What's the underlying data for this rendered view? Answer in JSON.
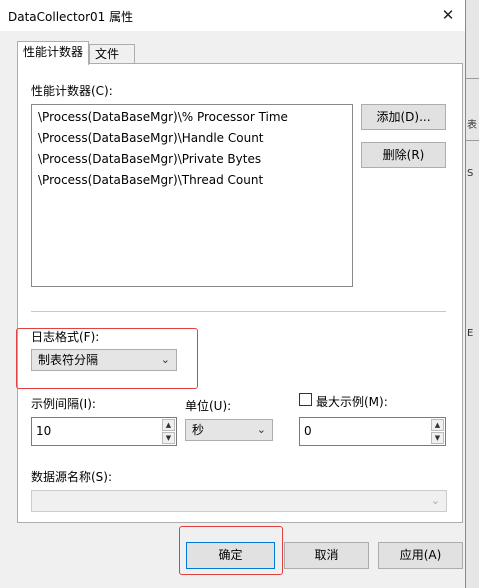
{
  "window": {
    "title": "DataCollector01 属性",
    "close_glyph": "✕"
  },
  "tabs": [
    {
      "label": "性能计数器"
    },
    {
      "label": "文件"
    }
  ],
  "counters": {
    "label": "性能计数器(C):",
    "items": [
      "\\Process(DataBaseMgr)\\% Processor Time",
      "\\Process(DataBaseMgr)\\Handle Count",
      "\\Process(DataBaseMgr)\\Private Bytes",
      "\\Process(DataBaseMgr)\\Thread Count"
    ],
    "add_label": "添加(D)...",
    "remove_label": "删除(R)"
  },
  "log_format": {
    "label": "日志格式(F):",
    "value": "制表符分隔"
  },
  "sample_interval": {
    "label": "示例间隔(I):",
    "value": "10"
  },
  "units": {
    "label": "单位(U):",
    "value": "秒"
  },
  "max_samples": {
    "label": "最大示例(M):",
    "value": "0",
    "checked": false
  },
  "data_source": {
    "label": "数据源名称(S):",
    "value": ""
  },
  "buttons": {
    "ok": "确定",
    "cancel": "取消",
    "apply": "应用(A)"
  },
  "background_window": {
    "labels": [
      "表",
      "S",
      "E"
    ]
  },
  "icons": {
    "dropdown": "chevron-down-icon",
    "spin_up": "up-arrow-icon",
    "spin_down": "down-arrow-icon",
    "close": "close-icon"
  },
  "colors": {
    "highlight": "#e04040",
    "accent": "#0078d7"
  }
}
